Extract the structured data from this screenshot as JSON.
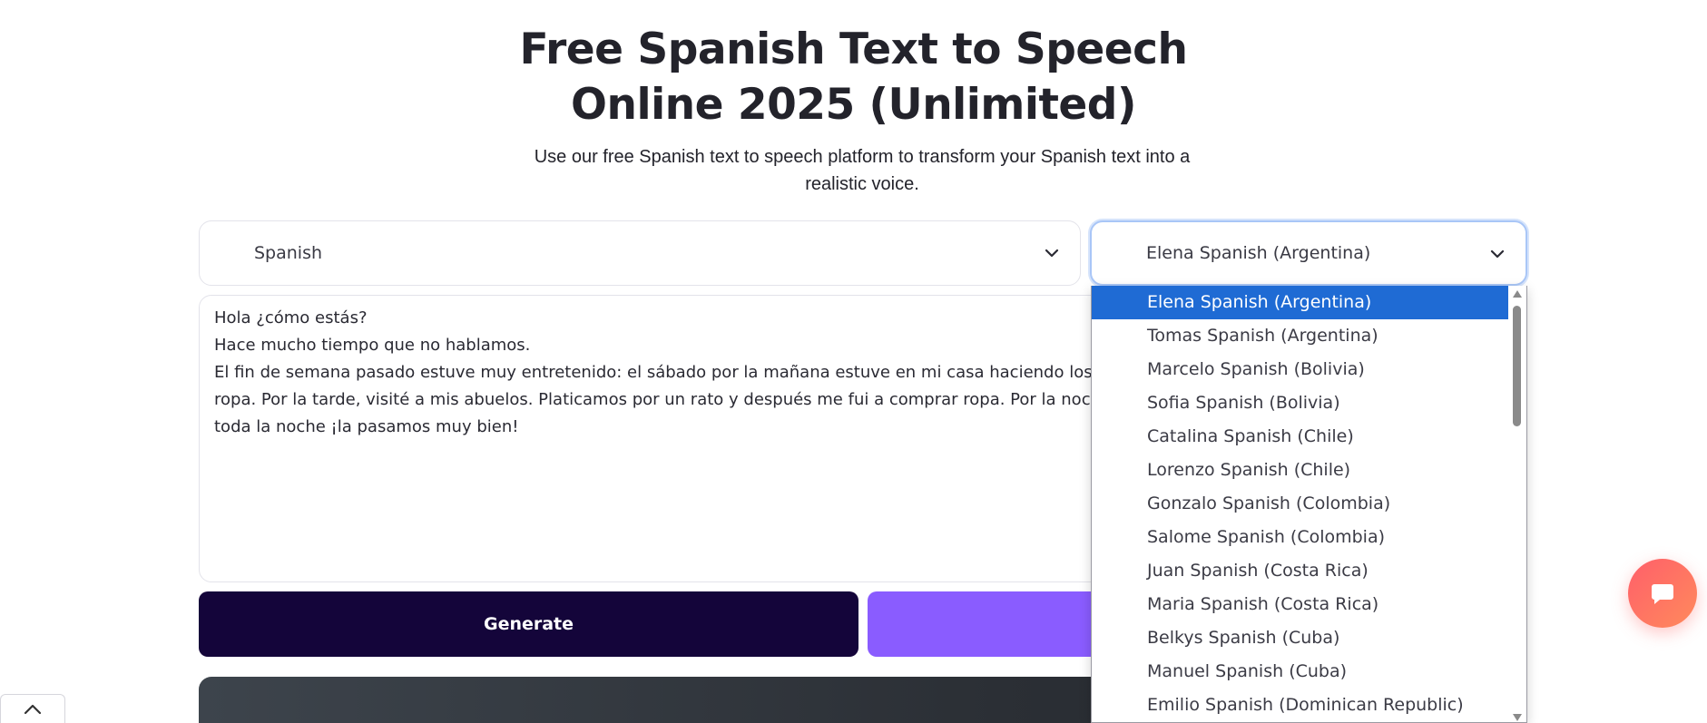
{
  "page": {
    "title_line1": "Free Spanish Text to Speech",
    "title_line2": "Online 2025 (Unlimited)",
    "subtitle": "Use our free Spanish text to speech platform to transform your Spanish text into a realistic voice."
  },
  "language_select": {
    "value": "Spanish",
    "icon": "chevron-down-icon"
  },
  "voice_select": {
    "value": "Elena Spanish (Argentina)",
    "icon": "chevron-down-icon",
    "options": [
      "Elena Spanish (Argentina)",
      "Tomas Spanish (Argentina)",
      "Marcelo Spanish (Bolivia)",
      "Sofia Spanish (Bolivia)",
      "Catalina Spanish (Chile)",
      "Lorenzo Spanish (Chile)",
      "Gonzalo Spanish (Colombia)",
      "Salome Spanish (Colombia)",
      "Juan Spanish (Costa Rica)",
      "Maria Spanish (Costa Rica)",
      "Belkys Spanish (Cuba)",
      "Manuel Spanish (Cuba)",
      "Emilio Spanish (Dominican Republic)"
    ]
  },
  "text_input": {
    "value": "Hola ¿cómo estás?\nHace mucho tiempo que no hablamos.\nEl fin de semana pasado estuve muy entretenido: el sábado por la mañana estuve en mi casa haciendo los que\nropa. Por la tarde, visité a mis abuelos. Platicamos por un rato y después me fui a comprar ropa. Por la noche, r\ntoda la noche ¡la pasamos muy bien!"
  },
  "buttons": {
    "generate_label": "Generate"
  },
  "colors": {
    "generate_bg": "#14053a",
    "purple_bg": "#8a5cff",
    "selected_option_bg": "#1f6bd4",
    "chat_button": "#ff6b6b"
  },
  "icons": {
    "chat": "chat-bubble-icon",
    "scroll_top": "chevron-up-icon"
  }
}
